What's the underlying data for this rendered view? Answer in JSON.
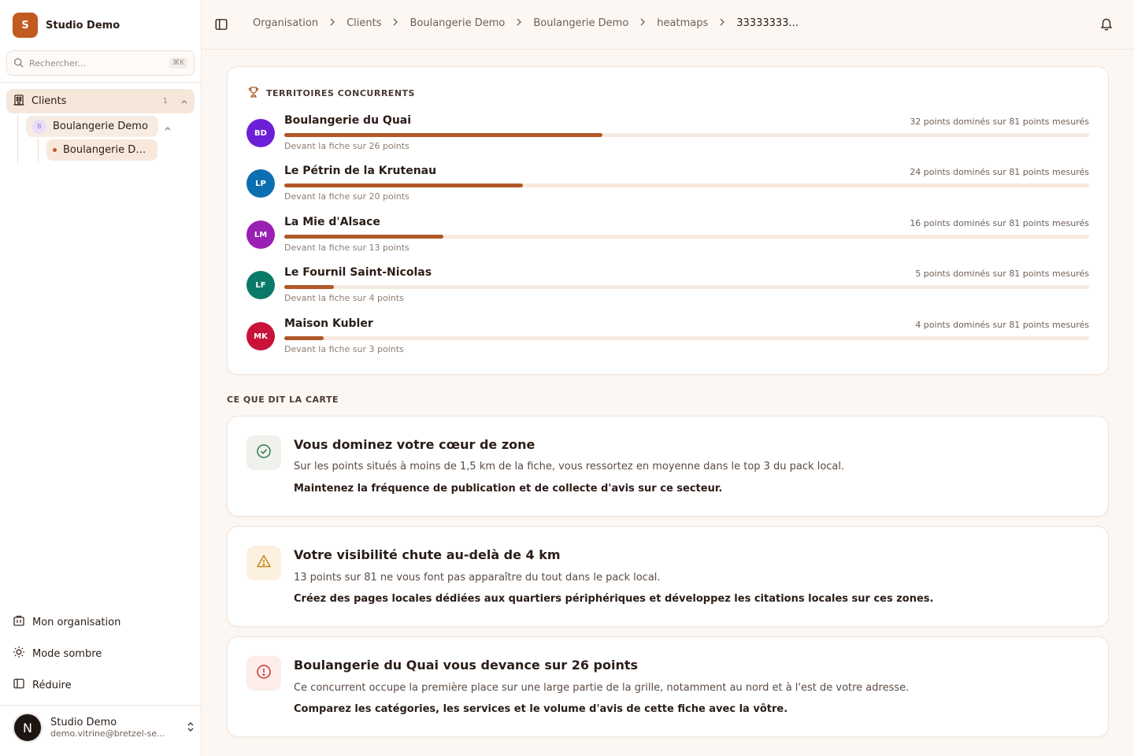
{
  "brand": {
    "initial": "S",
    "name": "Studio Demo"
  },
  "search": {
    "placeholder": "Rechercher...",
    "shortcut": "⌘K"
  },
  "sidebar": {
    "clients_label": "Clients",
    "clients_count": "1",
    "client_name": "Boulangerie Demo",
    "client_initial": "B",
    "location_name": "Boulangerie De...",
    "bottom": [
      {
        "label": "Mon organisation",
        "icon": "building-icon"
      },
      {
        "label": "Mode sombre",
        "icon": "sun-icon"
      },
      {
        "label": "Réduire",
        "icon": "sidebar-icon"
      }
    ],
    "user": {
      "initial": "N",
      "name": "Studio Demo",
      "email": "demo.vitrine@bretzel-se..."
    }
  },
  "breadcrumbs": [
    "Organisation",
    "Clients",
    "Boulangerie Demo",
    "Boulangerie Demo",
    "heatmaps",
    "33333333..."
  ],
  "competitors": {
    "title": "TERRITOIRES CONCURRENTS",
    "items": [
      {
        "initials": "BD",
        "name": "Boulangerie du Quai",
        "stat": "32 points dominés sur 81 points mesurés",
        "sub": "Devant la fiche sur 26 points",
        "ratio": 0.395,
        "color": "#6d1fd8"
      },
      {
        "initials": "LP",
        "name": "Le Pétrin de la Krutenau",
        "stat": "24 points dominés sur 81 points mesurés",
        "sub": "Devant la fiche sur 20 points",
        "ratio": 0.296,
        "color": "#0b6fb0"
      },
      {
        "initials": "LM",
        "name": "La Mie d'Alsace",
        "stat": "16 points dominés sur 81 points mesurés",
        "sub": "Devant la fiche sur 13 points",
        "ratio": 0.198,
        "color": "#9a1fb3"
      },
      {
        "initials": "LF",
        "name": "Le Fournil Saint-Nicolas",
        "stat": "5 points dominés sur 81 points mesurés",
        "sub": "Devant la fiche sur 4 points",
        "ratio": 0.062,
        "color": "#0a7a68"
      },
      {
        "initials": "MK",
        "name": "Maison Kubler",
        "stat": "4 points dominés sur 81 points mesurés",
        "sub": "Devant la fiche sur 3 points",
        "ratio": 0.049,
        "color": "#c8123a"
      }
    ]
  },
  "insights": {
    "section_title": "CE QUE DIT LA CARTE",
    "items": [
      {
        "icon": "check-circle-icon",
        "title": "Vous dominez votre cœur de zone",
        "text": "Sur les points situés à moins de 1,5 km de la fiche, vous ressortez en moyenne dans le top 3 du pack local.",
        "reco": "Maintenez la fréquence de publication et de collecte d'avis sur ce secteur.",
        "bg": "#eef1ec",
        "fg": "#2f7a4a"
      },
      {
        "icon": "warning-icon",
        "title": "Votre visibilité chute au-delà de 4 km",
        "text": "13 points sur 81 ne vous font pas apparaître du tout dans le pack local.",
        "reco": "Créez des pages locales dédiées aux quartiers périphériques et développez les citations locales sur ces zones.",
        "bg": "#fcf1e0",
        "fg": "#c58716"
      },
      {
        "icon": "alert-circle-icon",
        "title": "Boulangerie du Quai vous devance sur 26 points",
        "text": "Ce concurrent occupe la première place sur une large partie de la grille, notamment au nord et à l'est de votre adresse.",
        "reco": "Comparez les catégories, les services et le volume d'avis de cette fiche avec la vôtre.",
        "bg": "#fcecea",
        "fg": "#c8362e"
      }
    ]
  }
}
